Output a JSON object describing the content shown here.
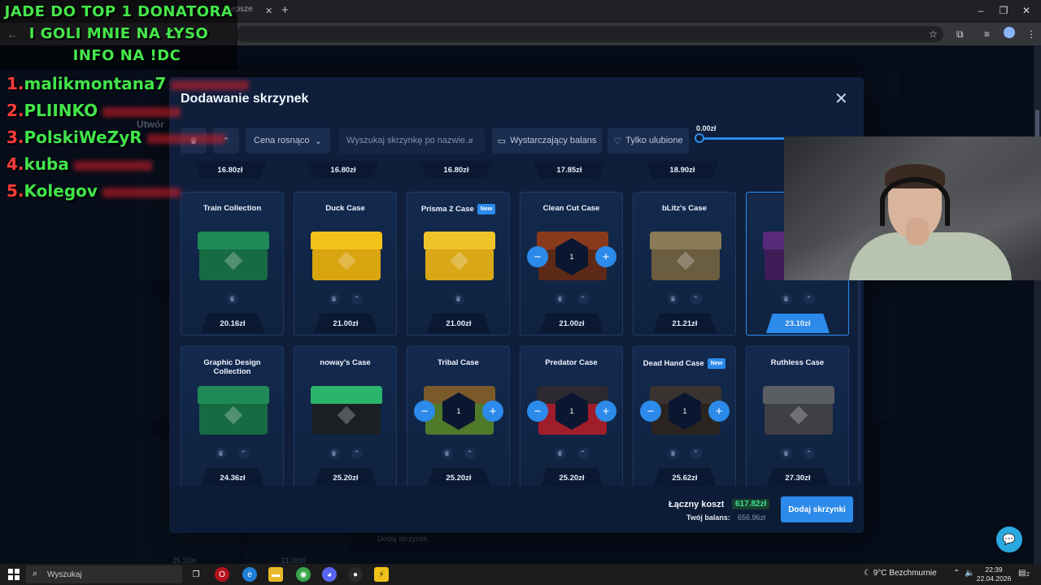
{
  "browser": {
    "tab_fragment": "epsze",
    "window_controls": [
      "minimize-icon",
      "maximize-icon",
      "close-icon"
    ]
  },
  "stream_overlay": {
    "title_lines": [
      "JADE DO TOP 1 DONATORA",
      "I GOLI MNIE NA ŁYSO",
      "INFO NA !DC"
    ],
    "donors": [
      {
        "rank": "1.",
        "name": "malikmontana7"
      },
      {
        "rank": "2.",
        "name": "PLIINKO"
      },
      {
        "rank": "3.",
        "name": "PolskiWeZyR"
      },
      {
        "rank": "4.",
        "name": "kuba"
      },
      {
        "rank": "5.",
        "name": "Kolegov"
      }
    ]
  },
  "background_page": {
    "created_label": "Utwór",
    "add_cases_label": "Dodaj skrzynek",
    "prices": [
      "25.20zł",
      "21.00zł"
    ]
  },
  "modal": {
    "title": "Dodawanie skrzynek",
    "sort_label": "Cena rosnąco",
    "search_placeholder": "Wyszukaj skrzynkę po nazwie...",
    "filter_balance": "Wystarczający balans",
    "filter_favorites": "Tylko ulubione",
    "range_min": "0.00zł",
    "top_row_prices": [
      "16.80zł",
      "16.80zł",
      "16.80zł",
      "17.85zł",
      "18.90zł"
    ],
    "cases": [
      {
        "name": "Train Collection",
        "price": "20.16zł",
        "new": false,
        "stepper": false,
        "selected": false,
        "lid": "#1f8a55",
        "body": "#176b42"
      },
      {
        "name": "Duck Case",
        "price": "21.00zł",
        "new": false,
        "stepper": false,
        "selected": false,
        "lid": "#f2c21b",
        "body": "#d9a50f"
      },
      {
        "name": "Prisma 2 Case",
        "price": "21.00zł",
        "new": true,
        "stepper": false,
        "selected": false,
        "lid": "#f0c22a",
        "body": "#d8a817"
      },
      {
        "name": "Clean Cut Case",
        "price": "21.00zł",
        "new": false,
        "stepper": true,
        "selected": false,
        "lid": "#8a3a1c",
        "body": "#5e2a18"
      },
      {
        "name": "bLitz's Case",
        "price": "21.21zł",
        "new": false,
        "stepper": false,
        "selected": false,
        "lid": "#8a7a55",
        "body": "#6b5d40"
      },
      {
        "name": "Cu",
        "price": "23.10zł",
        "new": false,
        "stepper": false,
        "selected": true,
        "lid": "#5a2a7a",
        "body": "#3e1d57"
      },
      {
        "name": "Graphic Design Collection",
        "price": "24.36zł",
        "new": false,
        "stepper": false,
        "selected": false,
        "lid": "#1f8a55",
        "body": "#176b42"
      },
      {
        "name": "noway's Case",
        "price": "25.20zł",
        "new": false,
        "stepper": false,
        "selected": false,
        "lid": "#2bb56a",
        "body": "#1a1f24"
      },
      {
        "name": "Tribal Case",
        "price": "25.20zł",
        "new": false,
        "stepper": true,
        "selected": false,
        "lid": "#7a5a2a",
        "body": "#4e7a2a"
      },
      {
        "name": "Predator Case",
        "price": "25.20zł",
        "new": false,
        "stepper": true,
        "selected": false,
        "lid": "#2a2a30",
        "body": "#a01e2a"
      },
      {
        "name": "Dead Hand Case",
        "price": "25.62zł",
        "new": true,
        "stepper": true,
        "selected": false,
        "lid": "#3a3430",
        "body": "#2a2420"
      },
      {
        "name": "Ruthless Case",
        "price": "27.30zł",
        "new": false,
        "stepper": false,
        "selected": false,
        "lid": "#5a5d62",
        "body": "#3e4045"
      }
    ],
    "new_badge": "New",
    "stepper_value": "1",
    "total_label": "Łączny koszt",
    "total_value": "617.82zł",
    "balance_label": "Twój balans:",
    "balance_value": "656.96zł",
    "add_button": "Dodaj skrzynki"
  },
  "taskbar": {
    "search_placeholder": "Wyszukaj",
    "weather": "9°C  Bezchmurnie",
    "time": "22:39",
    "date": "22.04.2026",
    "notification_count": "2"
  },
  "colors": {
    "accent": "#2b8aea",
    "overlay_green": "#42e44a",
    "overlay_red": "#ff3b3b"
  }
}
